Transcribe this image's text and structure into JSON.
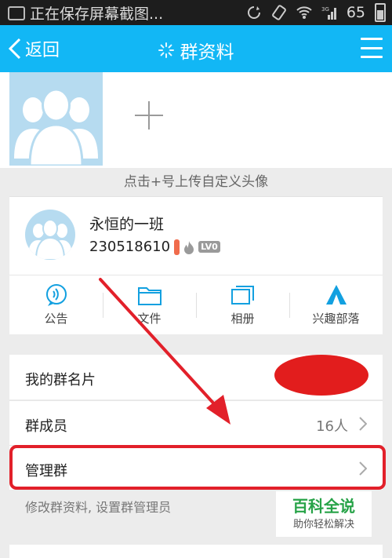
{
  "status_bar": {
    "notification_text": "正在保存屏幕截图...",
    "network_type": "3G",
    "battery_level": "65"
  },
  "app_bar": {
    "back_label": "返回",
    "title": "群资料",
    "accent_color": "#12b7f5"
  },
  "upload": {
    "hint": "点击+号上传自定义头像"
  },
  "group": {
    "name": "永恒的一班",
    "id": "230518610",
    "level_badge": "LV0"
  },
  "actions": [
    {
      "label": "公告",
      "icon": "announcement-icon"
    },
    {
      "label": "文件",
      "icon": "folder-icon"
    },
    {
      "label": "相册",
      "icon": "album-icon"
    },
    {
      "label": "兴趣部落",
      "icon": "tribe-icon"
    }
  ],
  "list": {
    "my_card_label": "我的群名片",
    "members_label": "群成员",
    "members_value": "16人",
    "manage_label": "管理群",
    "manage_desc": "修改群资料, 设置群管理员"
  },
  "watermark": {
    "title": "百科全说",
    "subtitle": "助你轻松解决"
  },
  "annotation_color": "#e2202a"
}
